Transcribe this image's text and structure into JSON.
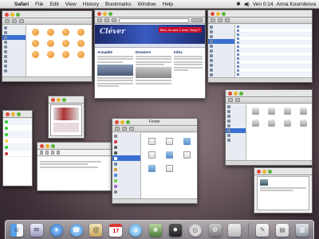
{
  "menubar": {
    "apple_glyph": "",
    "app_name": "Safari",
    "items": [
      "File",
      "Edit",
      "View",
      "History",
      "Bookmarks",
      "Window",
      "Help"
    ],
    "clock": "Ven 0:14",
    "user": "Anna Kournikova"
  },
  "browser": {
    "logo": "Cléver",
    "promo": "Bién, ils sont 1 avec \"easy\"?",
    "headlines": [
      "Actualité",
      "Dossiers",
      "Infos"
    ]
  },
  "finder_center": {
    "title": "Finder"
  },
  "icons": {
    "finder": "finder-icon",
    "mail": "mail-icon",
    "safari": "safari-icon",
    "ichat": "ichat-icon",
    "address_book": "address-book-icon",
    "ical": "ical-icon",
    "itunes": "itunes-icon",
    "iphoto": "iphoto-icon",
    "imovie": "imovie-icon",
    "idvd": "idvd-icon",
    "system_prefs": "system-preferences-icon",
    "apple": "apple-icon",
    "trash": "trash-icon"
  },
  "dock": {
    "ical_day": "17"
  }
}
